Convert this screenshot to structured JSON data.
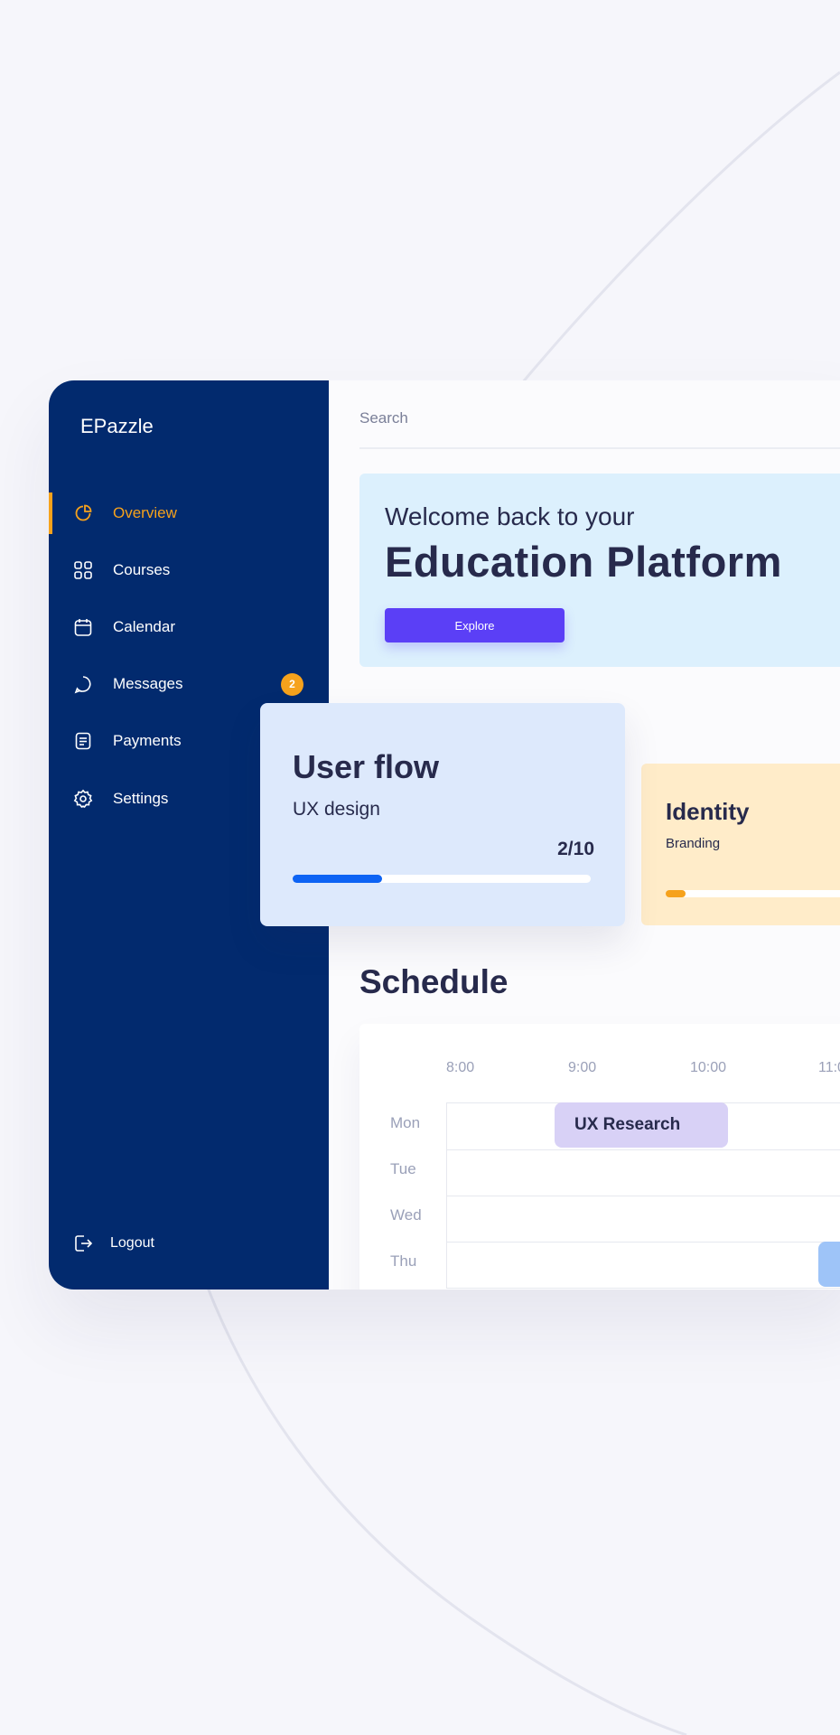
{
  "colors": {
    "sidebar_bg": "#022a6e",
    "accent_orange": "#f6a21c",
    "explore_button": "#5b3ff6",
    "hero_bg": "#dcf0fd",
    "flow_card_bg": "#dde9fc",
    "flow_progress": "#0d63f4",
    "identity_card_bg": "#ffecc9",
    "event_ux_research": "#d8d1f6",
    "event_thu": "#9ec4f8",
    "text_dark": "#272a4c"
  },
  "sidebar": {
    "brand": "EPazzle",
    "items": [
      {
        "label": "Overview",
        "icon": "pie-chart-icon",
        "active": true
      },
      {
        "label": "Courses",
        "icon": "grid-icon",
        "active": false
      },
      {
        "label": "Calendar",
        "icon": "calendar-icon",
        "active": false
      },
      {
        "label": "Messages",
        "icon": "chat-icon",
        "active": false,
        "badge": "2"
      },
      {
        "label": "Payments",
        "icon": "document-icon",
        "active": false
      },
      {
        "label": "Settings",
        "icon": "gear-icon",
        "active": false
      }
    ],
    "logout_label": "Logout",
    "logout_icon": "logout-icon"
  },
  "search": {
    "placeholder": "Search"
  },
  "hero": {
    "subtitle": "Welcome back to your",
    "title": "Education Platform",
    "button_label": "Explore"
  },
  "courses": [
    {
      "title": "User flow",
      "subtitle": "UX design",
      "progress_label": "2/10",
      "progress": 0.3
    },
    {
      "title": "Identity",
      "subtitle": "Branding",
      "progress": 0.1
    }
  ],
  "schedule": {
    "title": "Schedule",
    "times": [
      "8:00",
      "9:00",
      "10:00",
      "11:0"
    ],
    "days": [
      "Mon",
      "Tue",
      "Wed",
      "Thu"
    ],
    "events": [
      {
        "title": "UX Research",
        "day": "Mon",
        "start": "9:00",
        "end": "10:30"
      },
      {
        "title": "",
        "day": "Thu",
        "start": "11:00"
      }
    ]
  }
}
